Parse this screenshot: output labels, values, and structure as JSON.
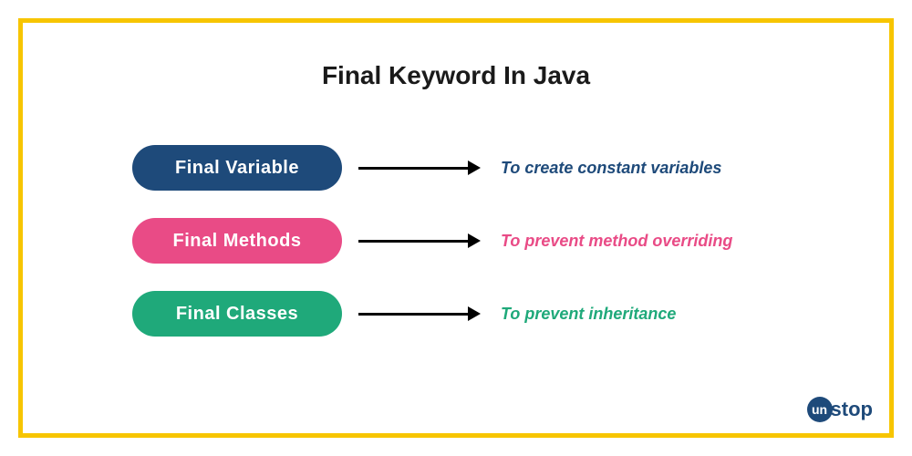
{
  "title": "Final Keyword In Java",
  "rows": [
    {
      "label": "Final  Variable",
      "desc": "To create constant variables"
    },
    {
      "label": "Final  Methods",
      "desc": "To prevent method overriding"
    },
    {
      "label": "Final  Classes",
      "desc": "To prevent inheritance"
    }
  ],
  "brand": {
    "badge": "un",
    "rest": "stop"
  }
}
